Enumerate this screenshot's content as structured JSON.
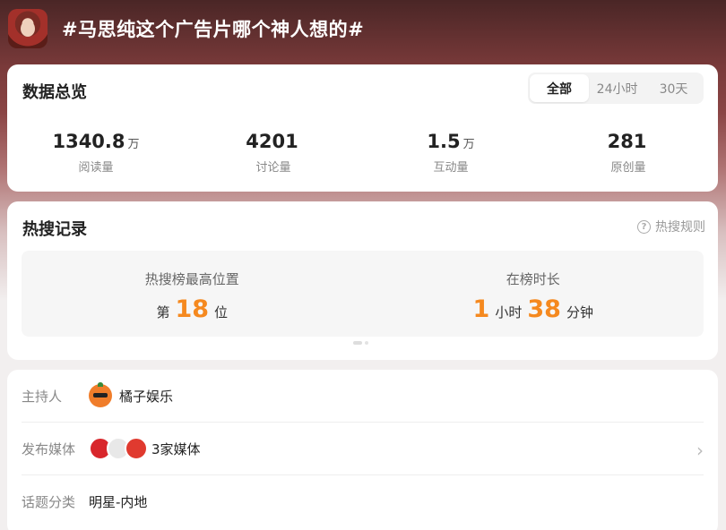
{
  "header": {
    "topic_title": "#马思纯这个广告片哪个神人想的#"
  },
  "overview": {
    "title": "数据总览",
    "tabs": [
      {
        "label": "全部",
        "active": true
      },
      {
        "label": "24小时",
        "active": false
      },
      {
        "label": "30天",
        "active": false
      }
    ],
    "stats": [
      {
        "value": "1340.8",
        "unit": "万",
        "label": "阅读量"
      },
      {
        "value": "4201",
        "unit": "",
        "label": "讨论量"
      },
      {
        "value": "1.5",
        "unit": "万",
        "label": "互动量"
      },
      {
        "value": "281",
        "unit": "",
        "label": "原创量"
      }
    ]
  },
  "hot_search": {
    "title": "热搜记录",
    "rules_label": "热搜规则",
    "peak_label": "热搜榜最高位置",
    "peak_prefix": "第",
    "peak_value": "18",
    "peak_suffix": "位",
    "duration_label": "在榜时长",
    "duration_hours": "1",
    "duration_hours_unit": "小时",
    "duration_minutes": "38",
    "duration_minutes_unit": "分钟"
  },
  "info": {
    "host_label": "主持人",
    "host_value": "橘子娱乐",
    "media_label": "发布媒体",
    "media_value": "3家媒体",
    "category_label": "话题分类",
    "category_value": "明星-内地"
  },
  "colors": {
    "accent": "#f5891f",
    "header_bg": "#6e3434"
  }
}
